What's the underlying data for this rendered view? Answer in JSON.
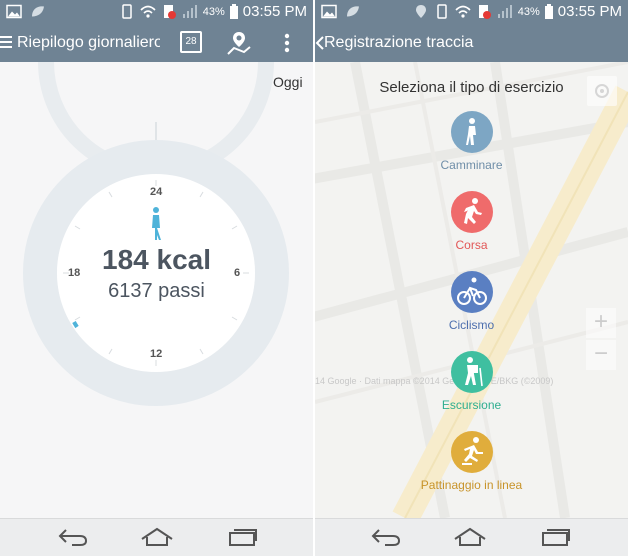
{
  "status_bar": {
    "battery_percent": "43%",
    "time": "03:55 PM"
  },
  "left_screen": {
    "header": {
      "title": "Riepilogo giornaliero",
      "calendar_day": "28"
    },
    "date_label": "Oggi",
    "dial": {
      "calories": "184 kcal",
      "steps": "6137 passi",
      "ticks": {
        "top": "24",
        "right": "6",
        "bottom": "12",
        "left": "18"
      }
    }
  },
  "right_screen": {
    "header": {
      "title": "Registrazione traccia"
    },
    "prompt": "Seleziona il tipo di esercizio",
    "activities": [
      {
        "label": "Camminare",
        "color": "#7da6c4",
        "icon": "walking-icon"
      },
      {
        "label": "Corsa",
        "color": "#ef6b6b",
        "icon": "running-icon"
      },
      {
        "label": "Ciclismo",
        "color": "#5a7fc2",
        "icon": "cycling-icon"
      },
      {
        "label": "Escursione",
        "color": "#3fbfa0",
        "icon": "hiking-icon"
      },
      {
        "label": "Pattinaggio in linea",
        "color": "#e0ad3c",
        "icon": "inline-skating-icon"
      }
    ],
    "map_attribution": "14 Google · Dati mappa ©2014 GeoBasis-DE/BKG (©2009)"
  },
  "colors": {
    "header": "#6f8394",
    "ring": "#e6ebef",
    "accent": "#4fb3d9"
  }
}
